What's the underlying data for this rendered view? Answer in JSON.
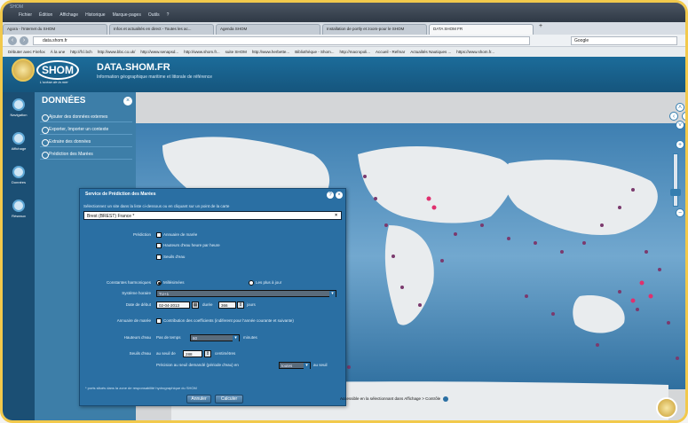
{
  "browser": {
    "window_title": "SHOM",
    "menus": [
      "Fichier",
      "Édition",
      "Affichage",
      "Historique",
      "Marque-pages",
      "Outils",
      "?"
    ],
    "tabs": [
      "Agora - l'Internet du SHOM",
      "Infos et actualités en direct - Toutes les ac...",
      "Agenda SHOM",
      "Installation de portly et zoom-pour le SHOM",
      "DATA SHOM FR"
    ],
    "new_tab": "+",
    "url": "data.shom.fr",
    "search_placeholder": "Google",
    "bookmarks": [
      "Débuter avec Firefox",
      "À la une",
      "http://fr.l.bch",
      "http://www.bbc.co.uk/",
      "http://www.senapsd...",
      "http://www.shom.fr...",
      "suite SHOM",
      "http://www.herbette...",
      "Bibliothèque - Shom...",
      "http://macropoli...",
      "Accueil - Refmar",
      "Actualités Nautiques ...",
      "https://www.shom.fr..."
    ]
  },
  "header": {
    "logo_text": "SHOM",
    "logo_tagline": "L'océan de la mer",
    "title": "DATA.SHOM.FR",
    "subtitle": "Information géographique maritime et littorale de référence"
  },
  "leftnav": {
    "items": [
      {
        "label": "Navigation"
      },
      {
        "label": "Affichage"
      },
      {
        "label": "Données"
      },
      {
        "label": "Réseaux"
      }
    ]
  },
  "donnees": {
    "title": "DONNÉES",
    "items": [
      "Ajouter des données externes",
      "Exporter, Importer un contexte",
      "Extraire des données",
      "Prédiction des Marées"
    ]
  },
  "dialog": {
    "title": "Service de Prédiction des Marées",
    "instruction": "Sélectionnez un site dans la liste ci-dessous ou en cliquant sur un point de la carte",
    "port": "Brest (BREST) France *",
    "prediction_label": "Prédiction",
    "prediction_options": [
      "Annuaire de marée",
      "Hauteurs d'eau heure par heure",
      "Seuils d'eau"
    ],
    "constants_label": "Constantes harmoniques",
    "constants_options": [
      "Millésimées",
      "Les plus à jour"
    ],
    "timezone_label": "Système horaire",
    "timezone_value": "TU+1",
    "date_label": "Date de début",
    "date_value": "02-04-2013",
    "duration_prefix": "durée",
    "duration_value": "366",
    "duration_unit": "jours",
    "annuaire_label": "Annuaire de marée",
    "annuaire_text": "Contribution des coefficients (indiferent pour l'année courante et suivante)",
    "heights_label": "Hauteurs d'eau",
    "heights_step_label": "Pas de temps",
    "heights_step_value": "60",
    "heights_unit": "minutes",
    "seuils_label": "Seuils d'eau",
    "seuils_prefix": "au seuil de",
    "seuils_value": "288",
    "seuils_unit": "centimètres",
    "seuils_detail": "Précision au seuil demandé (période d'eau) en",
    "seuils_select": "toutes",
    "seuils_after": "au seuil",
    "note": "* ports situés dans la zone de responsabilité hydrographique du SHOM",
    "btn_cancel": "Annuler",
    "btn_calc": "Calculer"
  },
  "map": {
    "legend_text": "Accessible en la sélectionnant dans Affichage > Contrôle"
  },
  "colors": {
    "header_blue": "#1c6c9a",
    "panel_blue": "#3d7ea8",
    "dialog_blue": "#2a6fa3",
    "frame": "#f2c94c"
  }
}
